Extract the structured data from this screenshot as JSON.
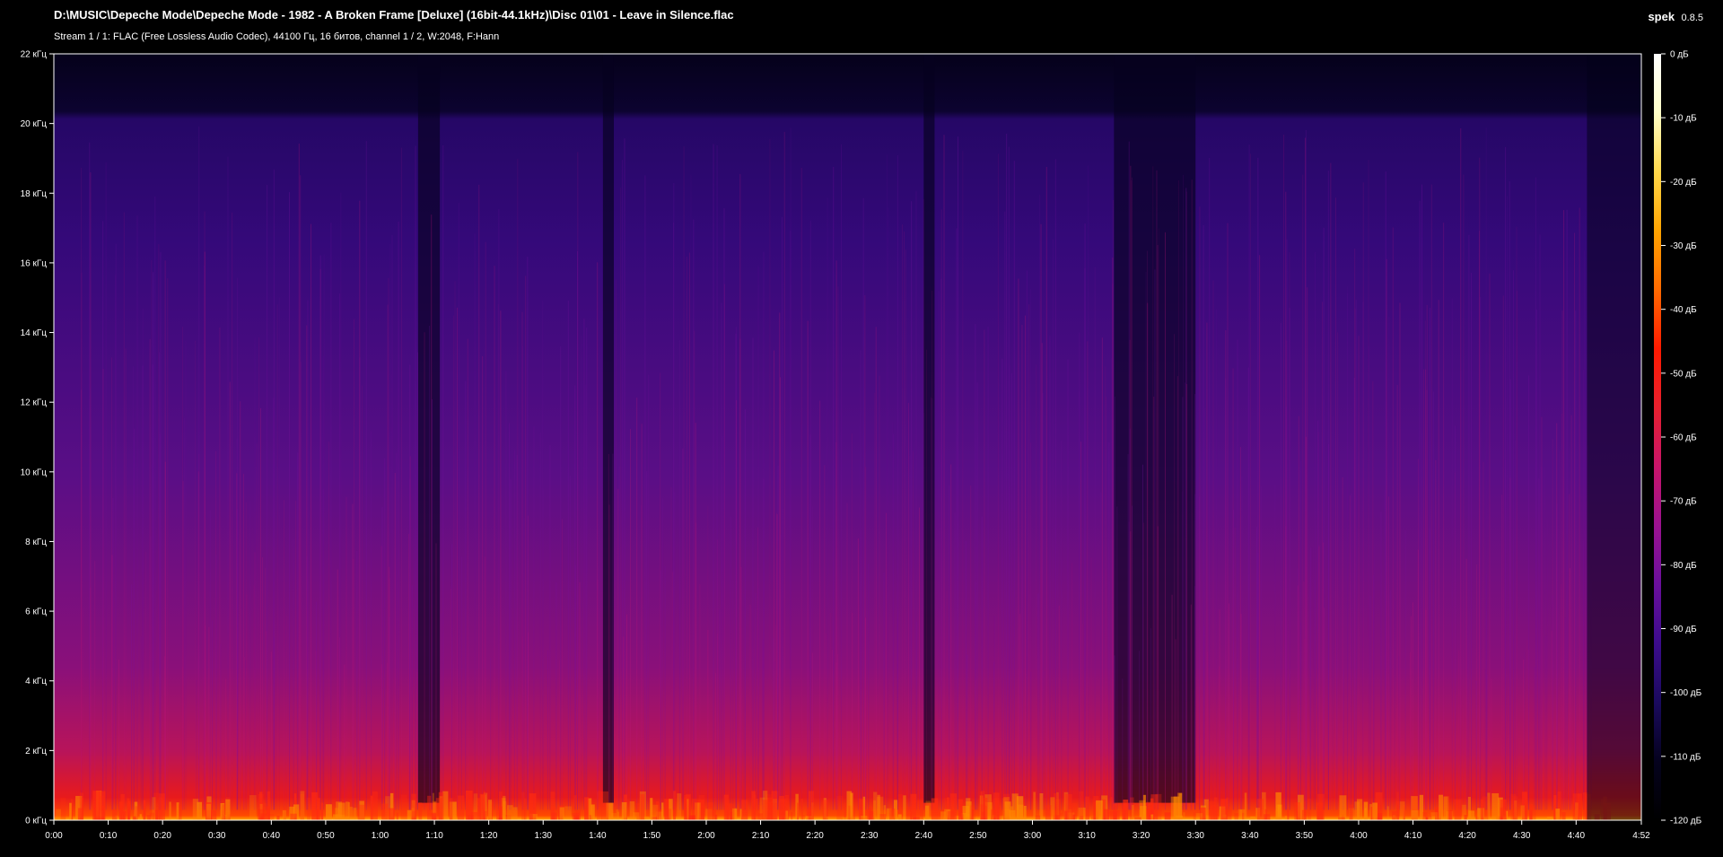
{
  "header": {
    "file_path": "D:\\MUSIC\\Depeche Mode\\Depeche Mode - 1982 - A Broken Frame [Deluxe] (16bit-44.1kHz)\\Disc 01\\01 - Leave in Silence.flac",
    "stream_info": "Stream 1 / 1: FLAC (Free Lossless Audio Codec), 44100 Гц, 16 битов, channel 1 / 2, W:2048, F:Hann"
  },
  "app": {
    "name": "spek",
    "version": "0.8.5"
  },
  "chart_data": {
    "type": "heatmap",
    "title": "",
    "xlabel": "",
    "ylabel": "",
    "x_ticks": [
      "0:00",
      "0:10",
      "0:20",
      "0:30",
      "0:40",
      "0:50",
      "1:00",
      "1:10",
      "1:20",
      "1:30",
      "1:40",
      "1:50",
      "2:00",
      "2:10",
      "2:20",
      "2:30",
      "2:40",
      "2:50",
      "3:00",
      "3:10",
      "3:20",
      "3:30",
      "3:40",
      "3:50",
      "4:00",
      "4:10",
      "4:20",
      "4:30",
      "4:40",
      "4:52"
    ],
    "x_range_seconds": [
      0,
      292
    ],
    "y_ticks": [
      "0 кГц",
      "2 кГц",
      "4 кГц",
      "6 кГц",
      "8 кГц",
      "10 кГц",
      "12 кГц",
      "14 кГц",
      "16 кГц",
      "18 кГц",
      "20 кГц",
      "22 кГц"
    ],
    "y_range_khz": [
      0,
      22
    ],
    "colorbar_ticks": [
      "0 дБ",
      "-10 дБ",
      "-20 дБ",
      "-30 дБ",
      "-40 дБ",
      "-50 дБ",
      "-60 дБ",
      "-70 дБ",
      "-80 дБ",
      "-90 дБ",
      "-100 дБ",
      "-110 дБ",
      "-120 дБ"
    ],
    "colorbar_range_db": [
      -120,
      0
    ],
    "colormap": [
      "#000000",
      "#05021e",
      "#1a0a5e",
      "#3c0c8c",
      "#6a0f9c",
      "#9b1290",
      "#c8156a",
      "#e8202e",
      "#ff1a00",
      "#ff6a00",
      "#ffa400",
      "#ffd84a",
      "#ffffc8",
      "#ffffff"
    ],
    "spectral_cutoff_khz": 20.2,
    "quiet_sections_seconds": [
      [
        67,
        71
      ],
      [
        101,
        103
      ],
      [
        160,
        162
      ],
      [
        195,
        210
      ]
    ]
  }
}
